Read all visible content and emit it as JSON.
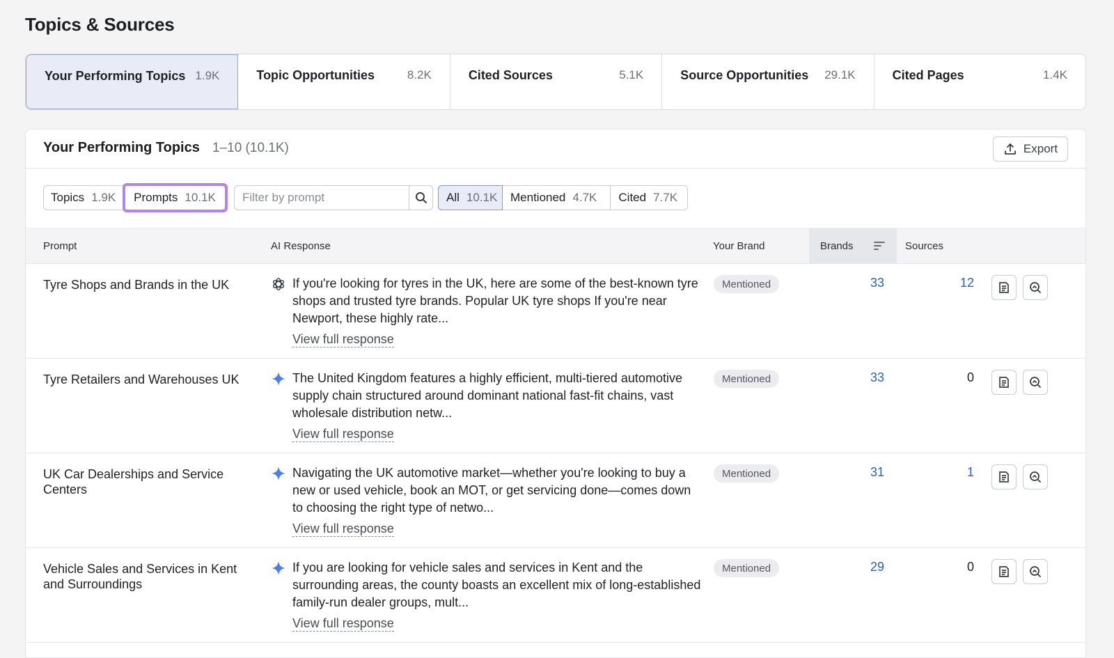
{
  "page": {
    "title": "Topics & Sources"
  },
  "tabs": [
    {
      "label": "Your Performing Topics",
      "count": "1.9K"
    },
    {
      "label": "Topic Opportunities",
      "count": "8.2K"
    },
    {
      "label": "Cited Sources",
      "count": "5.1K"
    },
    {
      "label": "Source Opportunities",
      "count": "29.1K"
    },
    {
      "label": "Cited Pages",
      "count": "1.4K"
    }
  ],
  "panel": {
    "title": "Your Performing Topics",
    "range": "1–10 (10.1K)",
    "export_label": "Export"
  },
  "view_toggle": [
    {
      "label": "Topics",
      "count": "1.9K"
    },
    {
      "label": "Prompts",
      "count": "10.1K"
    }
  ],
  "search": {
    "placeholder": "Filter by prompt",
    "value": ""
  },
  "status_filter": [
    {
      "label": "All",
      "count": "10.1K"
    },
    {
      "label": "Mentioned",
      "count": "4.7K"
    },
    {
      "label": "Cited",
      "count": "7.7K"
    }
  ],
  "columns": {
    "prompt": "Prompt",
    "ai_response": "AI Response",
    "your_brand": "Your Brand",
    "brands": "Brands",
    "sources": "Sources"
  },
  "rows": [
    {
      "prompt": "Tyre Shops and Brands in the UK",
      "ai_icon": "chatgpt-icon",
      "response": "If you're looking for tyres in the UK, here are some of the best-known tyre shops and trusted tyre brands. Popular UK tyre shops If you're near Newport, these highly rate...",
      "view_full": "View full response",
      "brand_status": "Mentioned",
      "brands": "33",
      "sources": "12"
    },
    {
      "prompt": "Tyre Retailers and Warehouses UK",
      "ai_icon": "gemini-icon",
      "response": "The United Kingdom features a highly efficient, multi-tiered automotive supply chain structured around dominant national fast-fit chains, vast wholesale distribution netw...",
      "view_full": "View full response",
      "brand_status": "Mentioned",
      "brands": "33",
      "sources": "0"
    },
    {
      "prompt": "UK Car Dealerships and Service Centers",
      "ai_icon": "gemini-icon",
      "response": "Navigating the UK automotive market—whether you're looking to buy a new or used vehicle, book an MOT, or get servicing done—comes down to choosing the right type of netwo...",
      "view_full": "View full response",
      "brand_status": "Mentioned",
      "brands": "31",
      "sources": "1"
    },
    {
      "prompt": "Vehicle Sales and Services in Kent and Surroundings",
      "ai_icon": "gemini-icon",
      "response": "If you are looking for vehicle sales and services in Kent and the surrounding areas, the county boasts an excellent mix of long-established family-run dealer groups, mult...",
      "view_full": "View full response",
      "brand_status": "Mentioned",
      "brands": "29",
      "sources": "0"
    }
  ],
  "colors": {
    "accent_blue": "#2461c2",
    "highlight_purple": "#b483f0",
    "active_tab_bg": "#e9ecf7"
  }
}
